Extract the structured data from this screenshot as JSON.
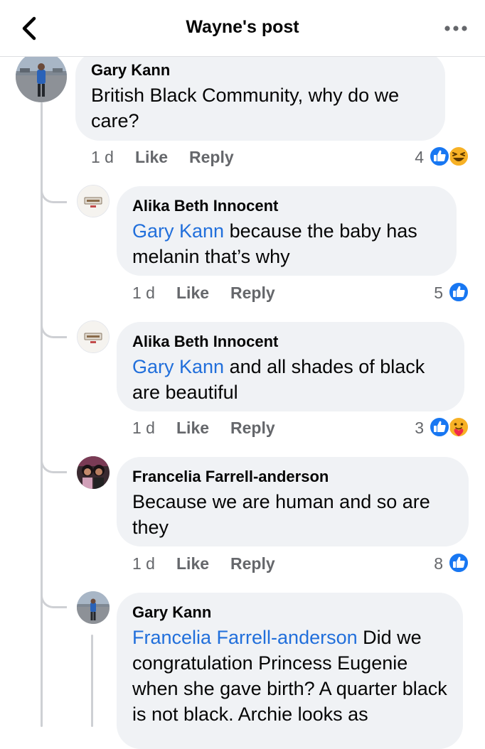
{
  "header": {
    "title": "Wayne's post",
    "back_icon": "chevron-left-icon",
    "more_icon": "more-dots-icon"
  },
  "colors": {
    "mention": "#216fdb",
    "bubble": "#f0f2f5",
    "like_blue": "#1877f2",
    "meta_gray": "#65676b"
  },
  "comments": [
    {
      "author": "Gary Kann",
      "text": "British Black Community, why do we care?",
      "time": "1 d",
      "like_label": "Like",
      "reply_label": "Reply",
      "reaction_count": "4",
      "reactions": [
        "like-reaction-icon",
        "haha-reaction-icon"
      ],
      "replies": [
        {
          "author": "Alika Beth Innocent",
          "mention": "Gary Kann",
          "text": " because the baby has melanin that’s why",
          "time": "1 d",
          "like_label": "Like",
          "reply_label": "Reply",
          "reaction_count": "5",
          "reactions": [
            "like-reaction-icon"
          ]
        },
        {
          "author": "Alika Beth Innocent",
          "mention": "Gary Kann",
          "text": " and all shades of black are beautiful",
          "time": "1 d",
          "like_label": "Like",
          "reply_label": "Reply",
          "reaction_count": "3",
          "reactions": [
            "like-reaction-icon",
            "care-reaction-icon"
          ]
        },
        {
          "author": "Francelia Farrell-anderson",
          "text": "Because we are human and so are they",
          "time": "1 d",
          "like_label": "Like",
          "reply_label": "Reply",
          "reaction_count": "8",
          "reactions": [
            "like-reaction-icon"
          ]
        },
        {
          "author": "Gary Kann",
          "mention": "Francelia Farrell-anderson",
          "text": " Did we congratulation Princess Eugenie when she gave birth? A quarter black is not black. Archie looks as"
        }
      ]
    }
  ]
}
